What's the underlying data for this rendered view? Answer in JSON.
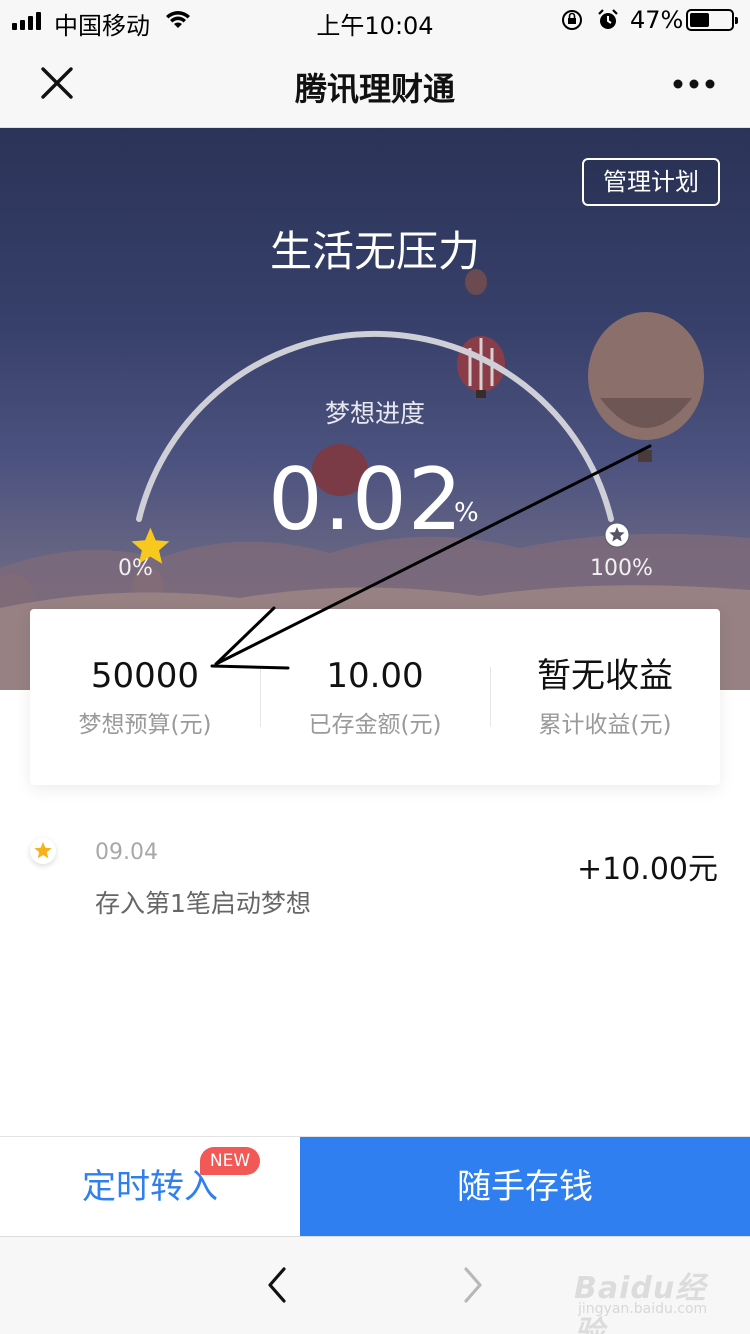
{
  "status_bar": {
    "carrier": "中国移动",
    "time": "上午10:04",
    "battery_percent": "47%",
    "battery_level": 0.47,
    "icons": [
      "signal-icon",
      "wifi-icon",
      "orientation-lock-icon",
      "alarm-icon",
      "battery-icon"
    ]
  },
  "nav": {
    "title": "腾讯理财通",
    "close_icon": "close-icon",
    "more_icon": "more-icon"
  },
  "hero": {
    "manage_button": "管理计划",
    "plan_name": "生活无压力",
    "progress_label": "梦想进度",
    "progress_value": "0.02",
    "progress_unit": "%",
    "progress_fraction": 0.0002,
    "arc_min_label": "0%",
    "arc_max_label": "100%",
    "colors": {
      "start_star": "#f7c81e",
      "arc": "#cfcfd8"
    }
  },
  "summary": {
    "stats": [
      {
        "value": "50000",
        "label": "梦想预算(元)"
      },
      {
        "value": "10.00",
        "label": "已存金额(元)"
      },
      {
        "value": "暂无收益",
        "label": "累计收益(元)"
      }
    ]
  },
  "records": [
    {
      "date": "09.04",
      "description": "存入第1笔启动梦想",
      "amount": "+10.00元"
    }
  ],
  "actions": {
    "scheduled_transfer": "定时转入",
    "new_badge": "NEW",
    "deposit_now": "随手存钱",
    "colors": {
      "primary": "#2f7ff0",
      "badge": "#f25856"
    }
  },
  "browser": {
    "back_icon": "chevron-left-icon",
    "forward_icon": "chevron-right-icon"
  },
  "watermark": {
    "text": "Baidu经验",
    "sub": "jingyan.baidu.com"
  }
}
